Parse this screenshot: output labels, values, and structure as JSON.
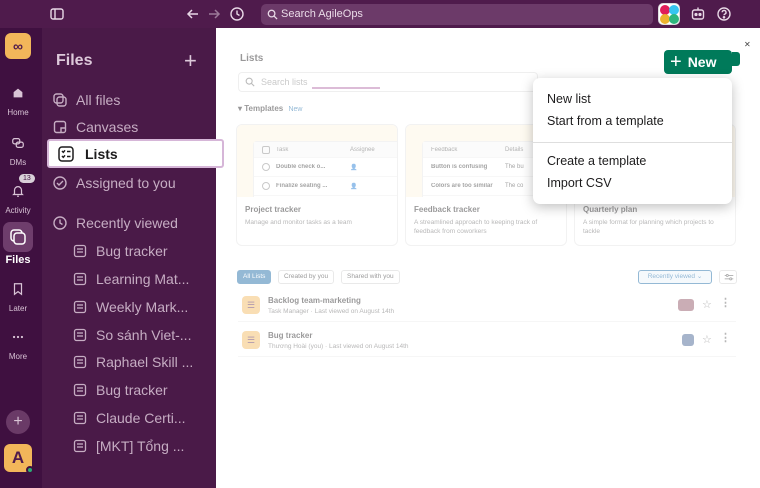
{
  "topbar": {
    "search_placeholder": "Search AgileOps"
  },
  "rail": {
    "workspace_logo": "∞",
    "items": [
      {
        "label": "Home"
      },
      {
        "label": "DMs"
      },
      {
        "label": "Activity",
        "badge": "13"
      },
      {
        "label": "Files"
      },
      {
        "label": "Later"
      },
      {
        "label": "More"
      }
    ],
    "add_label": "+",
    "user_initial": "A"
  },
  "sidebar": {
    "title": "Files",
    "items": [
      {
        "label": "All files"
      },
      {
        "label": "Canvases"
      },
      {
        "label": "Lists"
      },
      {
        "label": "Assigned to you"
      }
    ],
    "recent_header": "Recently viewed",
    "recent": [
      {
        "label": "Bug tracker"
      },
      {
        "label": "Learning Mat..."
      },
      {
        "label": "Weekly Mark..."
      },
      {
        "label": "So sánh Viet-..."
      },
      {
        "label": "Raphael Skill ..."
      },
      {
        "label": "Bug tracker"
      },
      {
        "label": "Claude Certi..."
      },
      {
        "label": "[MKT] Tổng ..."
      }
    ]
  },
  "main": {
    "title": "Lists",
    "search_placeholder": "Search lists",
    "templates_label": "Templates",
    "templates_new": "New",
    "cards": [
      {
        "title": "Project tracker",
        "desc": "Manage and monitor tasks as a team",
        "col1": "Task",
        "col2": "Assignee",
        "row1": "Double check o...",
        "row2": "Finalize seating ..."
      },
      {
        "title": "Feedback tracker",
        "desc": "A streamlined approach to keeping track of feedback from coworkers",
        "col1": "Feedback",
        "col2": "Details",
        "row1": "Button is confusing",
        "row1b": "The bu",
        "row2": "Colors are too similar",
        "row2b": "The co"
      },
      {
        "title": "Quarterly plan",
        "desc": "A simple format for planning which projects to tackle"
      }
    ],
    "filters": [
      "All Lists",
      "Created by you",
      "Shared with you"
    ],
    "sort_label": "Recently viewed ⌄",
    "rows": [
      {
        "title": "Backlog team-marketing",
        "sub": "Task Manager · Last viewed on August 14th"
      },
      {
        "title": "Bug tracker",
        "sub": "Thương Hoài (you) · Last viewed on August 14th"
      }
    ]
  },
  "new_button": {
    "label": "New"
  },
  "menu": {
    "items": [
      "New list",
      "Start from a template",
      "Create a template",
      "Import CSV"
    ]
  },
  "colors": {
    "aubergine": "#4a1a48",
    "rail": "#3f1040",
    "accent_green": "#007a5a",
    "link_blue": "#1264a3"
  }
}
